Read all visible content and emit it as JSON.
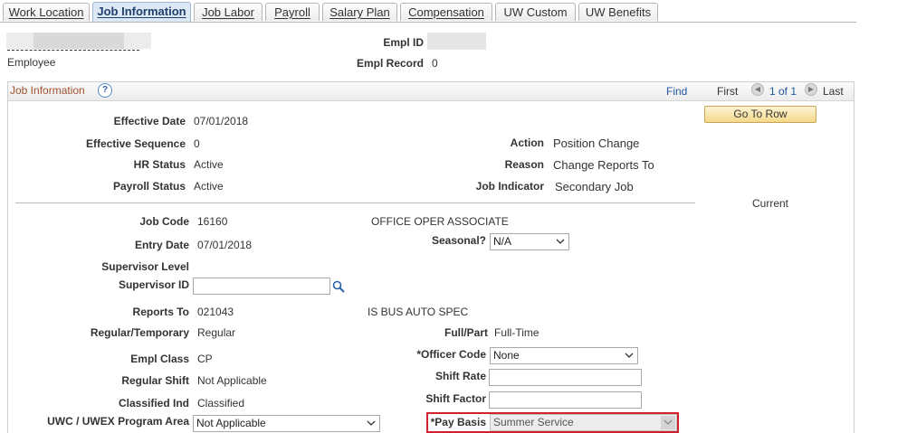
{
  "tabs": [
    {
      "label": "Work Location"
    },
    {
      "label": "Job Information"
    },
    {
      "label": "Job Labor"
    },
    {
      "label": "Payroll"
    },
    {
      "label": "Salary Plan"
    },
    {
      "label": "Compensation"
    },
    {
      "label": "UW Custom"
    },
    {
      "label": "UW Benefits"
    }
  ],
  "header": {
    "employee_label": "Employee",
    "empl_id_label": "Empl ID",
    "empl_record_label": "Empl Record",
    "empl_record_value": "0"
  },
  "section": {
    "title": "Job Information",
    "help_symbol": "?",
    "find": "Find",
    "first": "First",
    "count": "1 of 1",
    "last": "Last",
    "goto_row": "Go To Row",
    "current": "Current"
  },
  "fields": {
    "effective_date_label": "Effective Date",
    "effective_date": "07/01/2018",
    "effective_sequence_label": "Effective Sequence",
    "effective_sequence": "0",
    "hr_status_label": "HR Status",
    "hr_status": "Active",
    "payroll_status_label": "Payroll Status",
    "payroll_status": "Active",
    "action_label": "Action",
    "action": "Position Change",
    "reason_label": "Reason",
    "reason": "Change Reports To",
    "job_indicator_label": "Job Indicator",
    "job_indicator": "Secondary Job",
    "job_code_label": "Job Code",
    "job_code": "16160",
    "job_code_desc": "OFFICE OPER ASSOCIATE",
    "entry_date_label": "Entry Date",
    "entry_date": "07/01/2018",
    "seasonal_label": "Seasonal?",
    "seasonal": "N/A",
    "supervisor_level_label": "Supervisor Level",
    "supervisor_id_label": "Supervisor ID",
    "supervisor_id": "",
    "reports_to_label": "Reports To",
    "reports_to": "021043",
    "reports_to_desc": "IS BUS AUTO SPEC",
    "regular_temporary_label": "Regular/Temporary",
    "regular_temporary": "Regular",
    "full_part_label": "Full/Part",
    "full_part": "Full-Time",
    "empl_class_label": "Empl Class",
    "empl_class": "CP",
    "officer_code_label": "*Officer Code",
    "officer_code": "None",
    "regular_shift_label": "Regular Shift",
    "regular_shift": "Not Applicable",
    "shift_rate_label": "Shift Rate",
    "shift_rate": "",
    "classified_ind_label": "Classified Ind",
    "classified_ind": "Classified",
    "shift_factor_label": "Shift Factor",
    "shift_factor": "",
    "uwc_program_area_label": "UWC / UWEX Program Area",
    "uwc_program_area": "Not Applicable",
    "pay_basis_label": "*Pay Basis",
    "pay_basis": "Summer Service"
  },
  "colors": {
    "highlight": "#d21f2c",
    "link": "#22579e",
    "section_title": "#a0522d"
  },
  "icons": [
    "help-icon",
    "arrow-left-icon",
    "arrow-right-icon",
    "magnifier-icon",
    "chevron-down-icon"
  ]
}
